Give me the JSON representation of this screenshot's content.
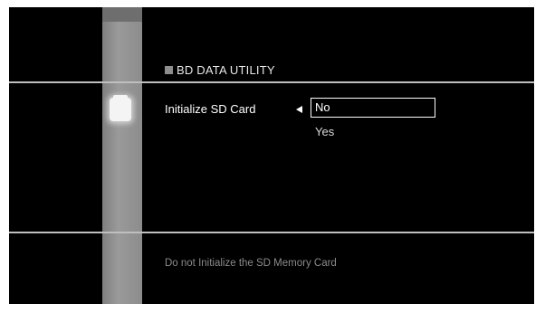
{
  "header": {
    "title": "BD DATA UTILITY"
  },
  "sidebar": {
    "icon": "sd-card-icon"
  },
  "setting": {
    "label": "Initialize SD Card",
    "options": [
      "No",
      "Yes"
    ],
    "selected": "No"
  },
  "footer": {
    "help_text": "Do not Initialize the SD Memory Card"
  },
  "colors": {
    "background": "#000000",
    "sidebar": "#8c8c8c",
    "divider": "#bfbfbf",
    "text": "#ffffff",
    "help_text": "#8a8a8a"
  }
}
